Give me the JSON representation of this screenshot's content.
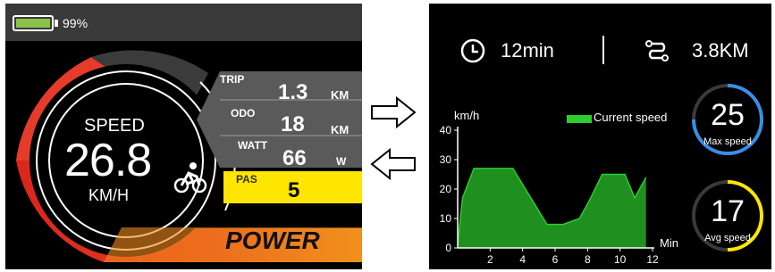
{
  "left_display": {
    "battery_percent": 99,
    "battery_label": "99%",
    "speed": {
      "label": "SPEED",
      "value": "26.8",
      "unit": "KM/H"
    },
    "trip": {
      "label": "TRIP",
      "value": "1.3",
      "unit": "KM"
    },
    "odo": {
      "label": "ODO",
      "value": "18",
      "unit": "KM"
    },
    "watt": {
      "label": "WATT",
      "value": "66",
      "unit": "W"
    },
    "pas": {
      "label": "PAS",
      "value": "5"
    },
    "power_label": "POWER",
    "icons": [
      "battery-icon",
      "bicycle-rider-icon"
    ],
    "colors": {
      "power_arc": "#e53b2a",
      "pas_highlight": "#ffe600",
      "battery_fill": "#8bc34a"
    }
  },
  "right_display": {
    "ride_time": "12min",
    "distance": "3.8KM",
    "max_speed": {
      "value": "25",
      "label": "Max speed",
      "ring_color": "#3a8ee6"
    },
    "avg_speed": {
      "value": "17",
      "label": "Avg speed",
      "ring_color": "#ffe600"
    },
    "icons": [
      "clock-icon",
      "route-icon"
    ]
  },
  "chart_data": {
    "type": "area",
    "ylabel": "km/h",
    "xlabel": "Min",
    "xlim": [
      0,
      12
    ],
    "ylim": [
      0,
      40
    ],
    "x_ticks": [
      2,
      4,
      6,
      8,
      10,
      12
    ],
    "y_ticks": [
      0,
      10,
      20,
      30,
      40
    ],
    "legend": "top-right",
    "series": [
      {
        "name": "Current speed",
        "color": "#2ecc2e",
        "x": [
          0,
          0.3,
          1,
          2,
          3.4,
          5.5,
          6.5,
          7.5,
          8.1,
          8.9,
          10.3,
          10.9,
          11.6
        ],
        "y": [
          1,
          17,
          27,
          27,
          27,
          8,
          8,
          10,
          16,
          25,
          25,
          17,
          24
        ]
      }
    ]
  },
  "arrows": {
    "forward": "right-arrow-icon",
    "back": "left-arrow-icon"
  }
}
